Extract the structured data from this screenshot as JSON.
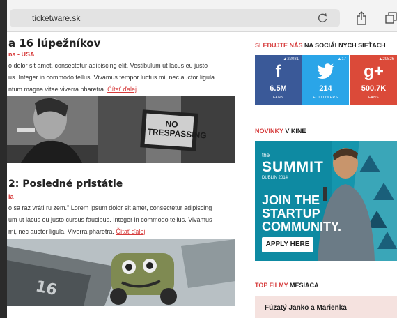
{
  "browser": {
    "url": "ticketware.sk"
  },
  "article1": {
    "title": "a 16 lúpežníkov",
    "meta": "na - USA",
    "lines": [
      "o dolor sit amet, consectetur adipiscing elit. Vestibulum ut lacus eu justo",
      "us. Integer in commodo tellus. Vivamus tempor luctus mi, nec auctor ligula.",
      "ntum magna vitae viverra pharetra."
    ],
    "more": "Čítať ďalej",
    "sign": "NO TRESPASSING"
  },
  "article2": {
    "title": "2: Posledné pristátie",
    "meta": "ia",
    "lines": [
      "o sa raz vráti ru zem.\" Lorem ipsum dolor sit amet, consectetur adipiscing",
      "um ut lacus eu justo cursus faucibus. Integer in commodo tellus. Vivamus",
      "mi, nec auctor ligula. Viverra pharetra."
    ],
    "more": "Čítať ďalej"
  },
  "sidebar": {
    "social_head_red": "SLEDUJTE NÁS",
    "social_head": " NA SOCIÁLNYCH SIEŤACH",
    "social": [
      {
        "icon": "f",
        "count": "▲22081",
        "value": "6.5M",
        "label": "FANS",
        "color": "#3a5998"
      },
      {
        "icon": "t",
        "count": "▲17",
        "value": "214",
        "label": "FOLLOWERS",
        "color": "#2aa5e8"
      },
      {
        "icon": "g+",
        "count": "▲29526",
        "value": "500.7K",
        "label": "FANS",
        "color": "#db4a39"
      }
    ],
    "news_head_red": "NOVINKY",
    "news_head": " V KINE",
    "ad": {
      "small": "the",
      "title": "SUMMIT",
      "sub": "DUBLIN 2014",
      "line1": "JOIN THE",
      "line2": "STARTUP",
      "line3": "COMMUNITY.",
      "button": "APPLY HERE"
    },
    "top_head_red": "TOP FILMY",
    "top_head": " MESIACA",
    "top_items": [
      "Fúzatý Janko a Marienka"
    ]
  }
}
